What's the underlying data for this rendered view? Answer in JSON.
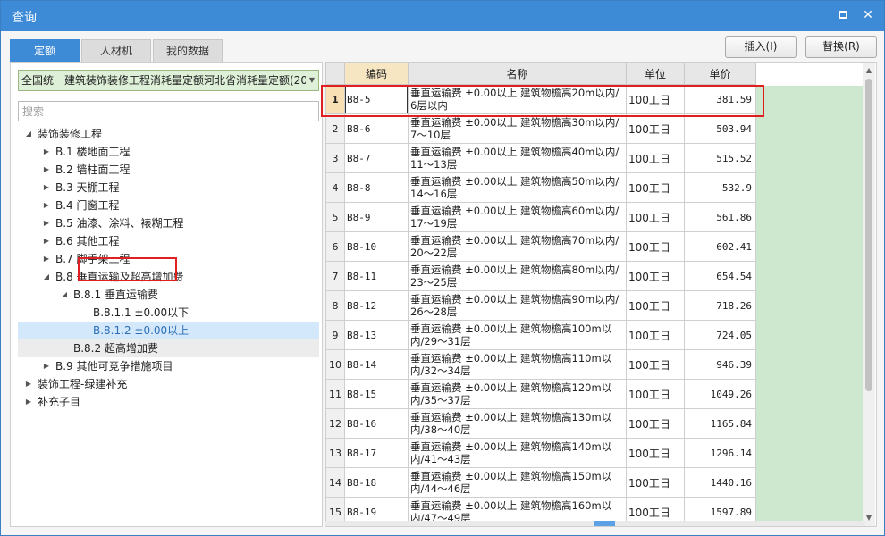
{
  "window": {
    "title": "查询"
  },
  "tabs": [
    {
      "label": "定额",
      "active": true
    },
    {
      "label": "人材机",
      "active": false
    },
    {
      "label": "我的数据",
      "active": false
    }
  ],
  "actions": {
    "insert_label": "插入(I)",
    "replace_label": "替换(R)"
  },
  "library": {
    "selected": "全国统一建筑装饰装修工程消耗量定额河北省消耗量定额(20"
  },
  "search": {
    "placeholder": "搜索"
  },
  "tree": [
    {
      "label": "装饰装修工程",
      "level": 0,
      "toggle": "expanded"
    },
    {
      "label": "B.1 楼地面工程",
      "level": 1,
      "toggle": "collapsed"
    },
    {
      "label": "B.2 墙柱面工程",
      "level": 1,
      "toggle": "collapsed"
    },
    {
      "label": "B.3 天棚工程",
      "level": 1,
      "toggle": "collapsed"
    },
    {
      "label": "B.4 门窗工程",
      "level": 1,
      "toggle": "collapsed"
    },
    {
      "label": "B.5 油漆、涂料、裱糊工程",
      "level": 1,
      "toggle": "collapsed"
    },
    {
      "label": "B.6 其他工程",
      "level": 1,
      "toggle": "collapsed"
    },
    {
      "label": "B.7 脚手架工程",
      "level": 1,
      "toggle": "collapsed"
    },
    {
      "label": "B.8 垂直运输及超高增加费",
      "level": 1,
      "toggle": "expanded"
    },
    {
      "label": "B.8.1 垂直运输费",
      "level": 2,
      "toggle": "expanded"
    },
    {
      "label": "B.8.1.1 ±0.00以下",
      "level": 3,
      "toggle": "none"
    },
    {
      "label": "B.8.1.2 ±0.00以上",
      "level": 3,
      "toggle": "none",
      "selected": true
    },
    {
      "label": "B.8.2 超高增加费",
      "level": 2,
      "toggle": "none",
      "grey": true
    },
    {
      "label": "B.9 其他可竞争措施项目",
      "level": 1,
      "toggle": "collapsed"
    },
    {
      "label": "装饰工程-绿建补充",
      "level": 0,
      "toggle": "collapsed"
    },
    {
      "label": "补充子目",
      "level": 0,
      "toggle": "collapsed"
    }
  ],
  "grid": {
    "headers": [
      "编码",
      "名称",
      "单位",
      "单价"
    ],
    "rows": [
      {
        "no": "1",
        "code": "B8-5",
        "name": "垂直运输费 ±0.00以上 建筑物檐高20m以内/6层以内",
        "unit": "100工日",
        "price": "381.59"
      },
      {
        "no": "2",
        "code": "B8-6",
        "name": "垂直运输费 ±0.00以上 建筑物檐高30m以内/7～10层",
        "unit": "100工日",
        "price": "503.94"
      },
      {
        "no": "3",
        "code": "B8-7",
        "name": "垂直运输费 ±0.00以上 建筑物檐高40m以内/11～13层",
        "unit": "100工日",
        "price": "515.52"
      },
      {
        "no": "4",
        "code": "B8-8",
        "name": "垂直运输费 ±0.00以上 建筑物檐高50m以内/14～16层",
        "unit": "100工日",
        "price": "532.9"
      },
      {
        "no": "5",
        "code": "B8-9",
        "name": "垂直运输费 ±0.00以上 建筑物檐高60m以内/17～19层",
        "unit": "100工日",
        "price": "561.86"
      },
      {
        "no": "6",
        "code": "B8-10",
        "name": "垂直运输费 ±0.00以上 建筑物檐高70m以内/20～22层",
        "unit": "100工日",
        "price": "602.41"
      },
      {
        "no": "7",
        "code": "B8-11",
        "name": "垂直运输费 ±0.00以上 建筑物檐高80m以内/23～25层",
        "unit": "100工日",
        "price": "654.54"
      },
      {
        "no": "8",
        "code": "B8-12",
        "name": "垂直运输费 ±0.00以上 建筑物檐高90m以内/26～28层",
        "unit": "100工日",
        "price": "718.26"
      },
      {
        "no": "9",
        "code": "B8-13",
        "name": "垂直运输费 ±0.00以上 建筑物檐高100m以内/29～31层",
        "unit": "100工日",
        "price": "724.05"
      },
      {
        "no": "10",
        "code": "B8-14",
        "name": "垂直运输费 ±0.00以上 建筑物檐高110m以内/32～34层",
        "unit": "100工日",
        "price": "946.39"
      },
      {
        "no": "11",
        "code": "B8-15",
        "name": "垂直运输费 ±0.00以上 建筑物檐高120m以内/35～37层",
        "unit": "100工日",
        "price": "1049.26"
      },
      {
        "no": "12",
        "code": "B8-16",
        "name": "垂直运输费 ±0.00以上 建筑物檐高130m以内/38～40层",
        "unit": "100工日",
        "price": "1165.84"
      },
      {
        "no": "13",
        "code": "B8-17",
        "name": "垂直运输费 ±0.00以上 建筑物檐高140m以内/41～43层",
        "unit": "100工日",
        "price": "1296.14"
      },
      {
        "no": "14",
        "code": "B8-18",
        "name": "垂直运输费 ±0.00以上 建筑物檐高150m以内/44～46层",
        "unit": "100工日",
        "price": "1440.16"
      },
      {
        "no": "15",
        "code": "B8-19",
        "name": "垂直运输费 ±0.00以上 建筑物檐高160m以内/47～49层",
        "unit": "100工日",
        "price": "1597.89"
      }
    ]
  }
}
